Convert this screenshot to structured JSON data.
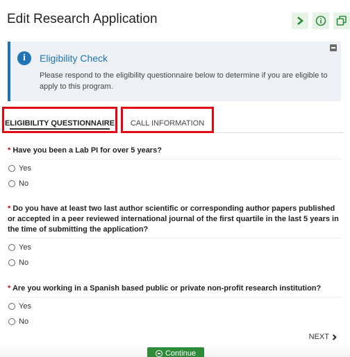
{
  "header": {
    "title": "Edit Research Application"
  },
  "notice": {
    "title": "Eligibility Check",
    "body": "Please respond to the eligibility questionnaire below to determine if you are eligible to apply to this program.",
    "icon": "info-icon"
  },
  "tabs": [
    {
      "label": "ELIGIBILITY QUESTIONNAIRE",
      "active": true
    },
    {
      "label": "CALL INFORMATION",
      "active": false
    }
  ],
  "questions": [
    {
      "required_marker": "*",
      "text": "Have you been a Lab PI for over 5 years?",
      "options": [
        "Yes",
        "No"
      ]
    },
    {
      "required_marker": "*",
      "text": "Do you have at least two last author scientific or corresponding author papers published or accepted in a peer reviewed international journal of the first quartile in the last 5 years in the time of submitting the application?",
      "options": [
        "Yes",
        "No"
      ]
    },
    {
      "required_marker": "*",
      "text": "Are you working in a Spanish based public or private non-profit research institution?",
      "options": [
        "Yes",
        "No"
      ]
    }
  ],
  "footer": {
    "next_label": "NEXT",
    "continue_label": "Continue"
  },
  "colors": {
    "accent": "#1f73b7",
    "highlight": "#e30613",
    "success": "#2e8b3a"
  }
}
